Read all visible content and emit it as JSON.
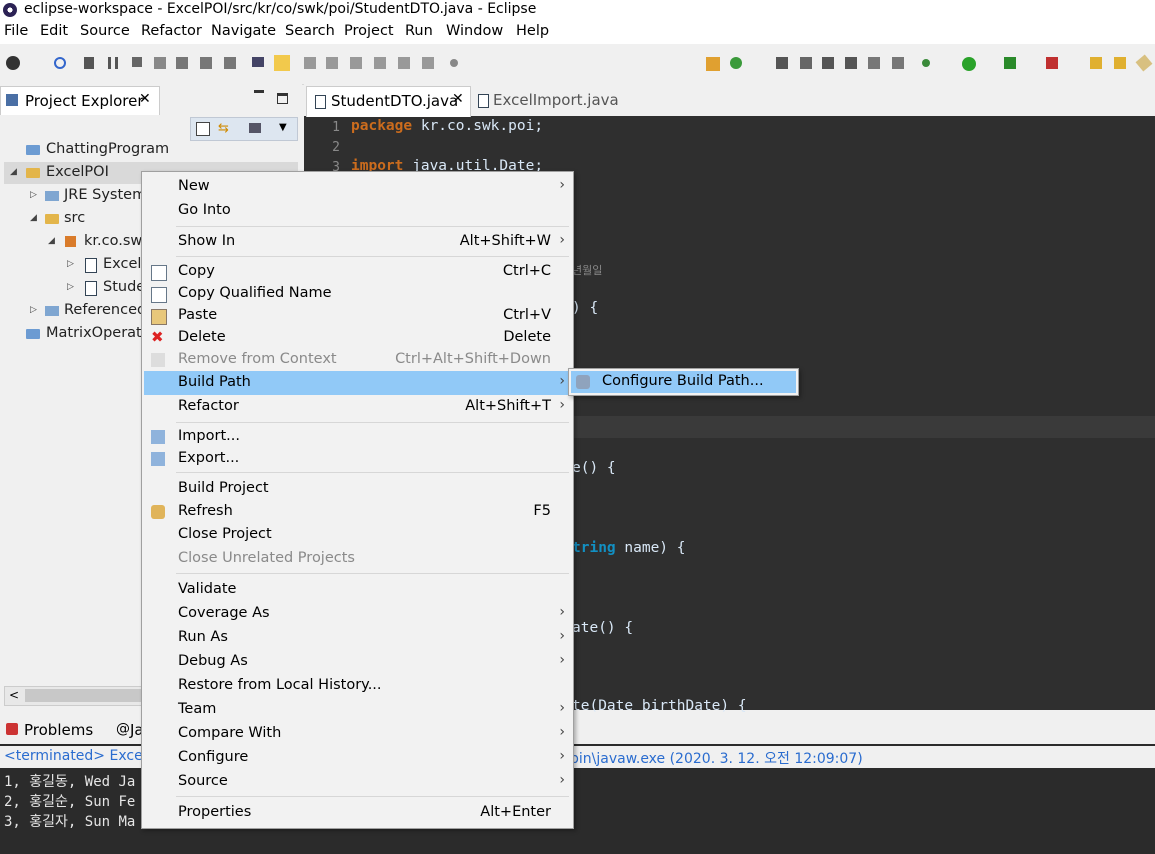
{
  "window": {
    "title": "eclipse-workspace - ExcelPOI/src/kr/co/swk/poi/StudentDTO.java - Eclipse"
  },
  "menubar": [
    "File",
    "Edit",
    "Source",
    "Refactor",
    "Navigate",
    "Search",
    "Project",
    "Run",
    "Window",
    "Help"
  ],
  "explorer": {
    "tab_label": "Project Explorer",
    "tree": {
      "chatting": "ChattingProgram",
      "excelpoi": "ExcelPOI",
      "jre": "JRE System",
      "src": "src",
      "package": "kr.co.swk",
      "excel_file": "Excell",
      "student_file": "Stude",
      "referenced": "Referenced",
      "matrix": "MatrixOperati"
    }
  },
  "editor": {
    "tabs": [
      "StudentDTO.java",
      "ExcelImport.java"
    ],
    "lines": {
      "l1_no": "1",
      "l1_kw": "package",
      "l1_rest": " kr.co.swk.poi;",
      "l2_no": "2",
      "l3_no": "3",
      "l3_kw": "import",
      "l3_rest": " java.util.Date;",
      "frag_comment": "년월일",
      "frag_brace1": ") {",
      "frag_get": "e() {",
      "frag_string": "tring",
      "frag_name": " name) {",
      "frag_date": "ate() {",
      "frag_set": "te(Date birthDate) {"
    }
  },
  "bottom": {
    "tabs": [
      "Problems",
      "Java"
    ],
    "console_header_left": "<terminated> Excell",
    "console_header_right": "bin\\javaw.exe (2020. 3. 12. 오전 12:09:07)",
    "console_lines": [
      "1, 홍길동, Wed Ja",
      "2, 홍길순, Sun Fe",
      "3, 홍길자, Sun Ma"
    ]
  },
  "context_menu": {
    "new": "New",
    "go_into": "Go Into",
    "show_in": "Show In",
    "show_in_acc": "Alt+Shift+W",
    "copy": "Copy",
    "copy_acc": "Ctrl+C",
    "copy_qualified": "Copy Qualified Name",
    "paste": "Paste",
    "paste_acc": "Ctrl+V",
    "delete": "Delete",
    "delete_acc": "Delete",
    "remove_context": "Remove from Context",
    "remove_context_acc": "Ctrl+Alt+Shift+Down",
    "build_path": "Build Path",
    "refactor": "Refactor",
    "refactor_acc": "Alt+Shift+T",
    "import": "Import...",
    "export": "Export...",
    "build_project": "Build Project",
    "refresh": "Refresh",
    "refresh_acc": "F5",
    "close_project": "Close Project",
    "close_unrelated": "Close Unrelated Projects",
    "validate": "Validate",
    "coverage_as": "Coverage As",
    "run_as": "Run As",
    "debug_as": "Debug As",
    "restore_history": "Restore from Local History...",
    "team": "Team",
    "compare_with": "Compare With",
    "configure": "Configure",
    "source": "Source",
    "properties": "Properties",
    "properties_acc": "Alt+Enter"
  },
  "submenu": {
    "configure_build_path": "Configure Build Path..."
  },
  "colors": {
    "menu_highlight": "#91c9f7",
    "editor_bg": "#2f2f2f",
    "keyword": "#cc6c1d"
  }
}
